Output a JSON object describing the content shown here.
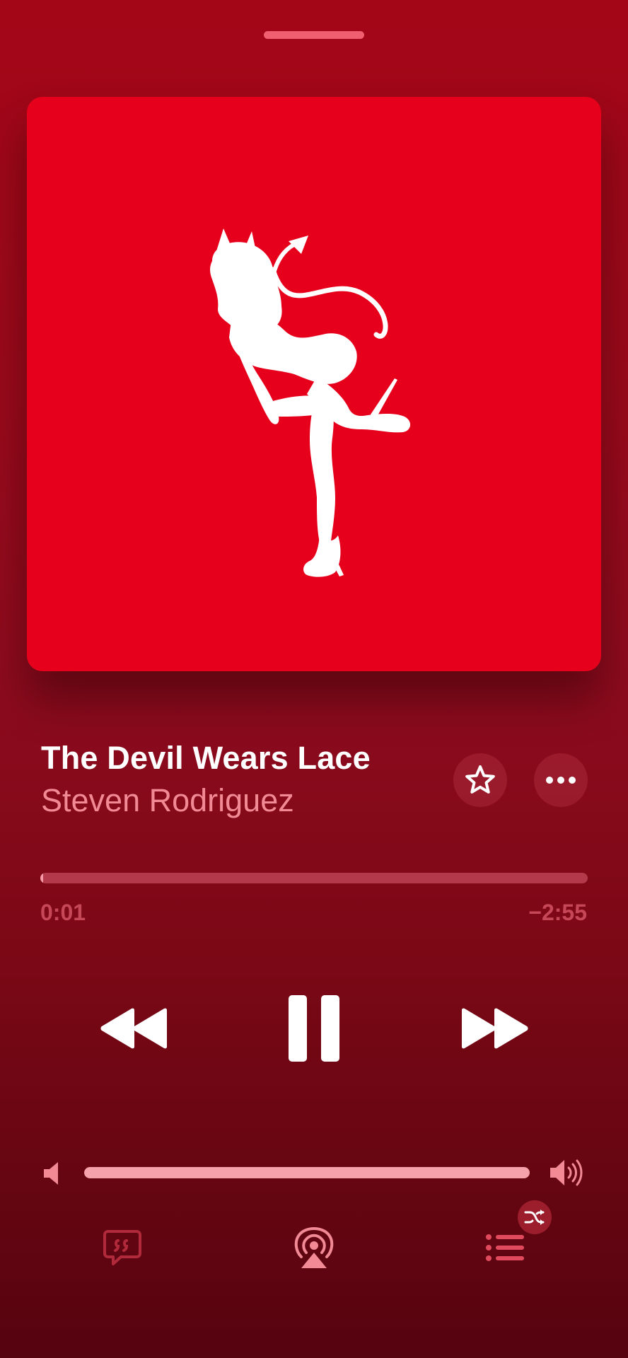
{
  "track": {
    "title": "The Devil Wears Lace",
    "artist": "Steven Rodriguez"
  },
  "artwork": {
    "background_color": "#e6001c",
    "icon": "devil-silhouette-icon"
  },
  "playback": {
    "elapsed": "0:01",
    "remaining": "−2:55",
    "progress_fraction": 0.005,
    "state": "playing"
  },
  "volume": {
    "level_fraction": 1.0
  },
  "controls": {
    "favorite_icon": "star-icon",
    "more_icon": "ellipsis-icon",
    "rewind_icon": "rewind-icon",
    "pause_icon": "pause-icon",
    "forward_icon": "fast-forward-icon",
    "lyrics_icon": "lyrics-icon",
    "airplay_icon": "airplay-icon",
    "queue_icon": "queue-list-icon",
    "shuffle_icon": "shuffle-icon"
  },
  "colors": {
    "background_top": "#a30617",
    "background_bottom": "#560410",
    "accent_pink": "#f28a96",
    "track_inactive": "#b3394b"
  }
}
